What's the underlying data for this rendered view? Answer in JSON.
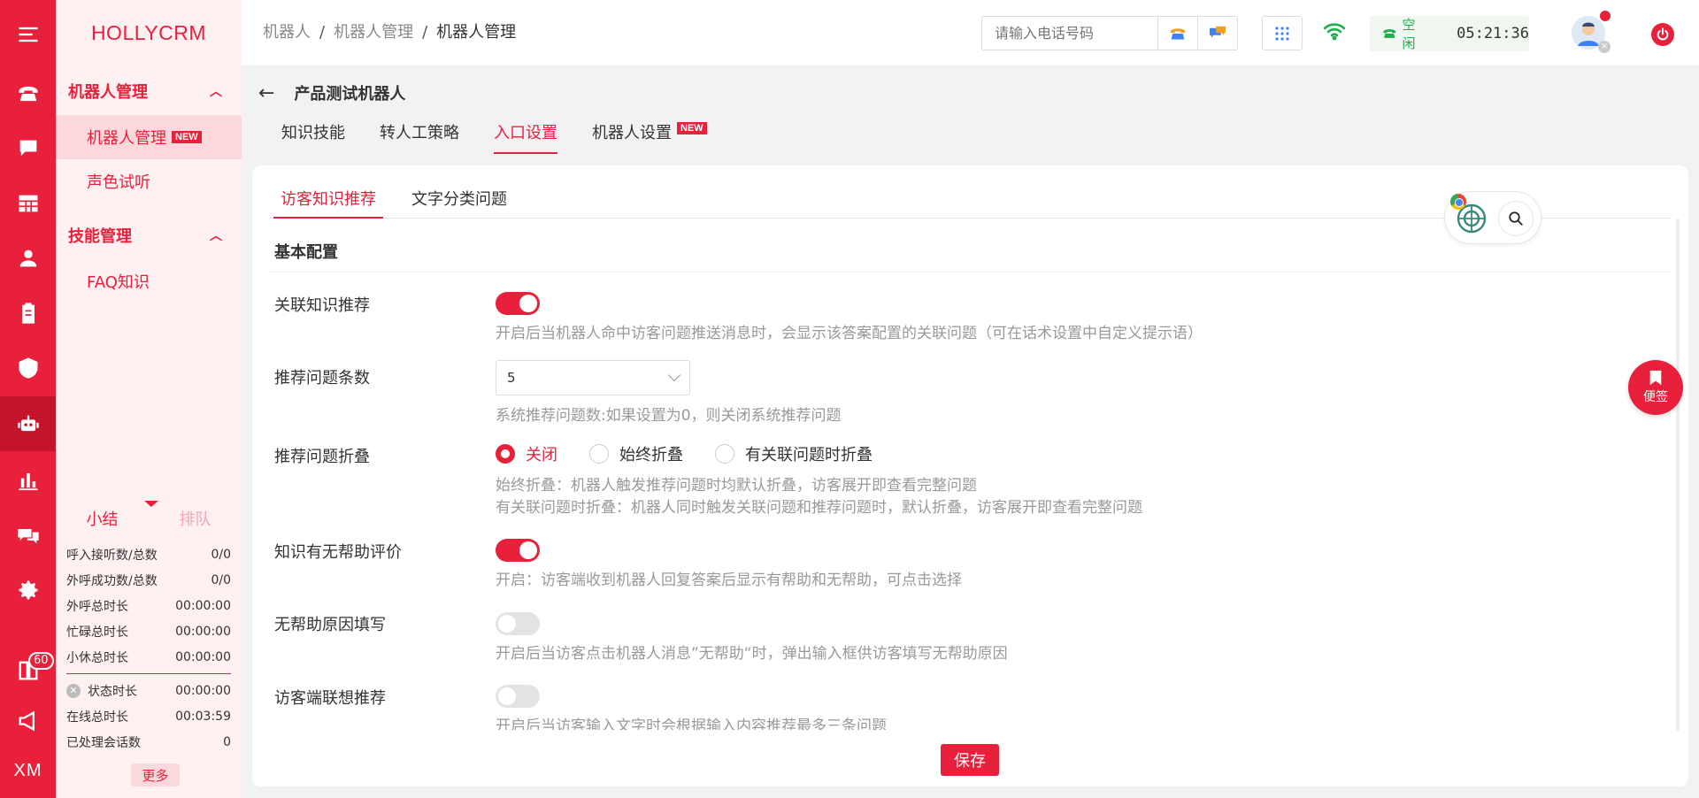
{
  "app": {
    "brand": "HOLLYCRM"
  },
  "rail": {
    "badge_count": "60",
    "user_initials": "XM"
  },
  "sidebar": {
    "groups": [
      {
        "title": "机器人管理",
        "items": [
          {
            "label": "机器人管理",
            "tag": "NEW",
            "active": true
          },
          {
            "label": "声色试听"
          }
        ]
      },
      {
        "title": "技能管理",
        "items": [
          {
            "label": "FAQ知识"
          }
        ]
      }
    ]
  },
  "stats": {
    "tabs": [
      "小结",
      "排队"
    ],
    "rows": [
      {
        "label": "呼入接听数/总数",
        "value": "0/0"
      },
      {
        "label": "外呼成功数/总数",
        "value": "0/0"
      },
      {
        "label": "外呼总时长",
        "value": "00:00:00"
      },
      {
        "label": "忙碌总时长",
        "value": "00:00:00"
      },
      {
        "label": "小休总时长",
        "value": "00:00:00"
      }
    ],
    "rows2": [
      {
        "label": "状态时长",
        "value": "00:00:00"
      },
      {
        "label": "在线总时长",
        "value": "00:03:59"
      },
      {
        "label": "已处理会话数",
        "value": "0"
      }
    ],
    "more": "更多"
  },
  "header": {
    "breadcrumb": [
      "机器人",
      "机器人管理",
      "机器人管理"
    ],
    "phone_placeholder": "请输入电话号码",
    "status": "空闲",
    "time": "05:21:36"
  },
  "page": {
    "title": "产品测试机器人",
    "tabs": [
      {
        "label": "知识技能"
      },
      {
        "label": "转人工策略"
      },
      {
        "label": "入口设置",
        "active": true
      },
      {
        "label": "机器人设置",
        "tag": "NEW"
      }
    ],
    "sub_tabs": [
      "访客知识推荐",
      "文字分类问题"
    ],
    "section_title": "基本配置",
    "settings": {
      "related_recommend": {
        "label": "关联知识推荐",
        "on": true,
        "help": "开启后当机器人命中访客问题推送消息时，会显示该答案配置的关联问题（可在话术设置中自定义提示语）"
      },
      "recommend_count": {
        "label": "推荐问题条数",
        "value": "5",
        "help": "系统推荐问题数:如果设置为0，则关闭系统推荐问题"
      },
      "recommend_fold": {
        "label": "推荐问题折叠",
        "options": [
          "关闭",
          "始终折叠",
          "有关联问题时折叠"
        ],
        "selected": "关闭",
        "help1": "始终折叠：机器人触发推荐问题时均默认折叠，访客展开即查看完整问题",
        "help2": "有关联问题时折叠：机器人同时触发关联问题和推荐问题时，默认折叠，访客展开即查看完整问题"
      },
      "helpful_eval": {
        "label": "知识有无帮助评价",
        "on": true,
        "help": "开启：访客端收到机器人回复答案后显示有帮助和无帮助，可点击选择"
      },
      "unhelpful_reason": {
        "label": "无帮助原因填写",
        "on": false,
        "help": "开启后当访客点击机器人消息”无帮助“时，弹出输入框供访客填写无帮助原因"
      },
      "visitor_suggest": {
        "label": "访客端联想推荐",
        "on": false,
        "help": "开启后当访客输入文字时会根据输入内容推荐最多三条问题"
      }
    },
    "save_label": "保存",
    "sticky_note": "便签"
  },
  "colors": {
    "accent": "#e8203b",
    "sidebar_bg": "#fff1f2",
    "status_green": "#18b04a"
  }
}
